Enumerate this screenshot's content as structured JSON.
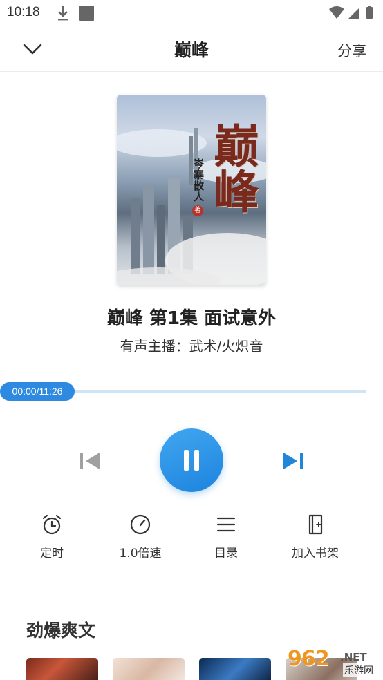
{
  "status_bar": {
    "time": "10:18"
  },
  "header": {
    "title": "巅峰",
    "share_label": "分享"
  },
  "cover": {
    "title": "巅峰",
    "author": "岑寨散人",
    "author_mark": "著"
  },
  "episode": {
    "title": "巅峰 第1集 面试意外",
    "narrator": "有声主播：武术/火炽音"
  },
  "player": {
    "time_display": "00:00/11:26",
    "progress": 0.0,
    "state": "playing"
  },
  "actions": [
    {
      "label": "定时",
      "icon": "alarm-clock-icon"
    },
    {
      "label": "1.0倍速",
      "icon": "speedometer-icon"
    },
    {
      "label": "目录",
      "icon": "list-menu-icon"
    },
    {
      "label": "加入书架",
      "icon": "add-bookshelf-icon"
    }
  ],
  "section": {
    "title": "劲爆爽文"
  },
  "watermark": {
    "number": "962",
    "suffix": ".NET",
    "text": "乐游网"
  },
  "colors": {
    "accent": "#2d8ae0",
    "track": "#cfe4f6",
    "icon_gray": "#9a9a9a"
  }
}
